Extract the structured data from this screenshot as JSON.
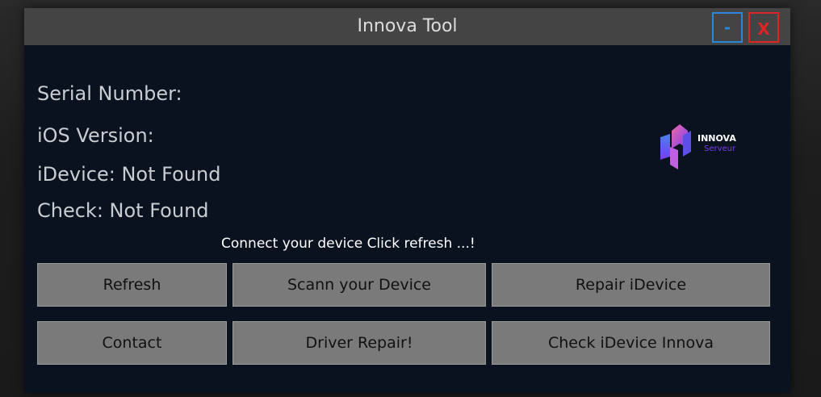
{
  "window": {
    "title": "Innova Tool",
    "minimize_label": "-",
    "close_label": "X"
  },
  "info": {
    "serial_number": "Serial Number:",
    "ios_version": "iOS Version:",
    "idevice": "iDevice: Not Found",
    "check": "Check: Not Found"
  },
  "logo": {
    "name": "INNOVA",
    "subtitle": "Serveur"
  },
  "status_message": "Connect your device  Click refresh ...!",
  "buttons": {
    "refresh": "Refresh",
    "scan": "Scann your Device",
    "repair": "Repair iDevice",
    "contact": "Contact",
    "driver_repair": "Driver Repair!",
    "check_innova": "Check iDevice Innova"
  },
  "colors": {
    "window_bg": "#0a1220",
    "titlebar_bg": "#444444",
    "minimize_accent": "#2a86d9",
    "close_accent": "#e02424",
    "button_bg": "#7a7a7a",
    "logo_purple": "#7a3df0"
  }
}
